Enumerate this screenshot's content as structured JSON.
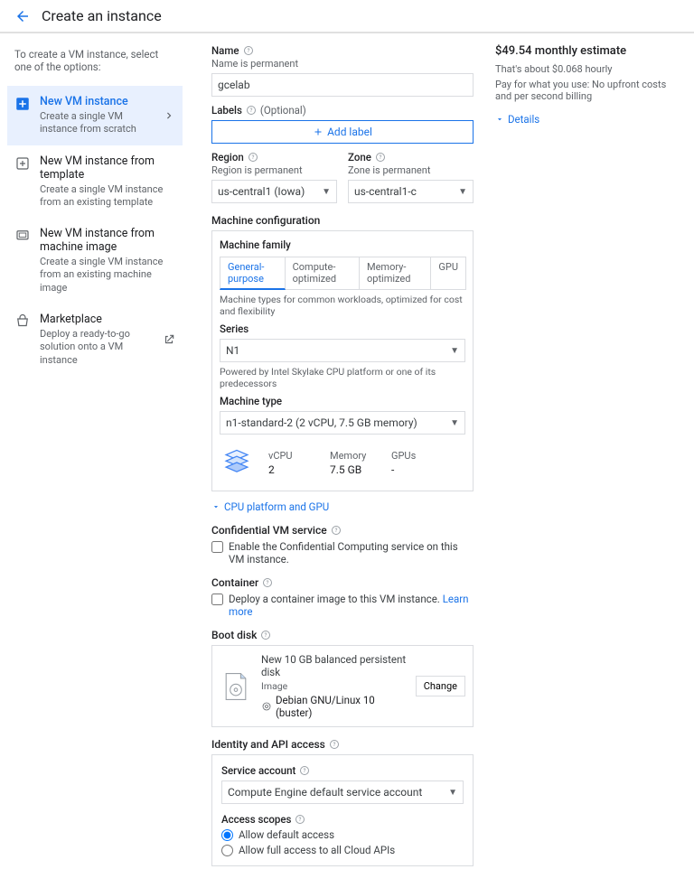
{
  "header": {
    "title": "Create an instance"
  },
  "sidebar": {
    "intro": "To create a VM instance, select one of the options:",
    "items": [
      {
        "title": "New VM instance",
        "sub": "Create a single VM instance from scratch"
      },
      {
        "title": "New VM instance from template",
        "sub": "Create a single VM instance from an existing template"
      },
      {
        "title": "New VM instance from machine image",
        "sub": "Create a single VM instance from an existing machine image"
      },
      {
        "title": "Marketplace",
        "sub": "Deploy a ready-to-go solution onto a VM instance"
      }
    ]
  },
  "form": {
    "name_label": "Name",
    "name_hint": "Name is permanent",
    "name_value": "gcelab",
    "labels_label": "Labels",
    "labels_optional": "(Optional)",
    "add_label_btn": "Add label",
    "region_label": "Region",
    "region_hint": "Region is permanent",
    "region_value": "us-central1 (Iowa)",
    "zone_label": "Zone",
    "zone_hint": "Zone is permanent",
    "zone_value": "us-central1-c",
    "machine_config_title": "Machine configuration",
    "machine_family_label": "Machine family",
    "family_tabs": [
      "General-purpose",
      "Compute-optimized",
      "Memory-optimized",
      "GPU"
    ],
    "family_hint": "Machine types for common workloads, optimized for cost and flexibility",
    "series_label": "Series",
    "series_value": "N1",
    "series_hint": "Powered by Intel Skylake CPU platform or one of its predecessors",
    "machine_type_label": "Machine type",
    "machine_type_value": "n1-standard-2 (2 vCPU, 7.5 GB memory)",
    "spec_vcpu_label": "vCPU",
    "spec_vcpu_value": "2",
    "spec_mem_label": "Memory",
    "spec_mem_value": "7.5 GB",
    "spec_gpu_label": "GPUs",
    "spec_gpu_value": "-",
    "cpu_expand": "CPU platform and GPU",
    "confidential_title": "Confidential VM service",
    "confidential_check": "Enable the Confidential Computing service on this VM instance.",
    "container_title": "Container",
    "container_check": "Deploy a container image to this VM instance.",
    "container_learn": "Learn more",
    "boot_disk_title": "Boot disk",
    "boot_disk_name": "New 10 GB balanced persistent disk",
    "boot_disk_image_label": "Image",
    "boot_disk_os": "Debian GNU/Linux 10 (buster)",
    "boot_disk_change": "Change",
    "identity_title": "Identity and API access",
    "service_account_label": "Service account",
    "service_account_value": "Compute Engine default service account",
    "access_scopes_label": "Access scopes",
    "scope_default": "Allow default access",
    "scope_full": "Allow full access to all Cloud APIs"
  },
  "cost": {
    "title": "$49.54 monthly estimate",
    "hourly": "That's about $0.068 hourly",
    "note": "Pay for what you use: No upfront costs and per second billing",
    "details": "Details"
  }
}
